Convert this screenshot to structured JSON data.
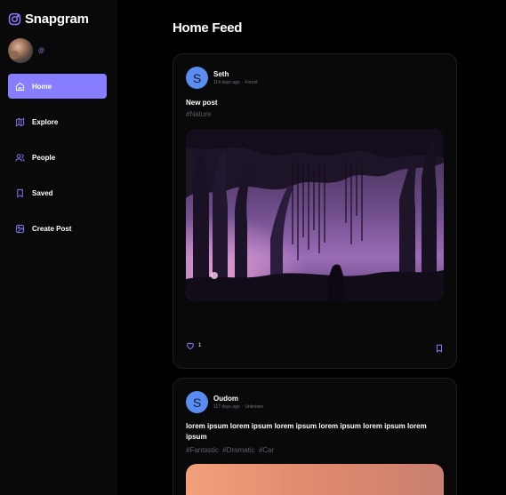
{
  "app": {
    "name": "Snapgram",
    "accent": "#877eff"
  },
  "profile": {
    "handle": "@"
  },
  "nav": {
    "items": [
      {
        "label": "Home",
        "icon": "home-icon",
        "active": true
      },
      {
        "label": "Explore",
        "icon": "explore-icon",
        "active": false
      },
      {
        "label": "People",
        "icon": "people-icon",
        "active": false
      },
      {
        "label": "Saved",
        "icon": "saved-icon",
        "active": false
      },
      {
        "label": "Create Post",
        "icon": "create-post-icon",
        "active": false
      }
    ]
  },
  "page": {
    "title": "Home Feed"
  },
  "posts": [
    {
      "avatar_letter": "S",
      "author": "Seth",
      "time": "114 days ago",
      "location": "Forest",
      "caption": "New post",
      "tags": [
        "#Nature"
      ],
      "likes": "1",
      "image": "forest-image"
    },
    {
      "avatar_letter": "S",
      "author": "Oudom",
      "time": "117 days ago",
      "location": "Unknown",
      "caption": "lorem ipsum lorem ipsum lorem ipsum lorem ipsum lorem ipsum lorem ipsum",
      "tags": [
        "#Fantastic",
        "#Dramatic",
        "#Car"
      ],
      "image": "warm-gradient-image"
    }
  ]
}
